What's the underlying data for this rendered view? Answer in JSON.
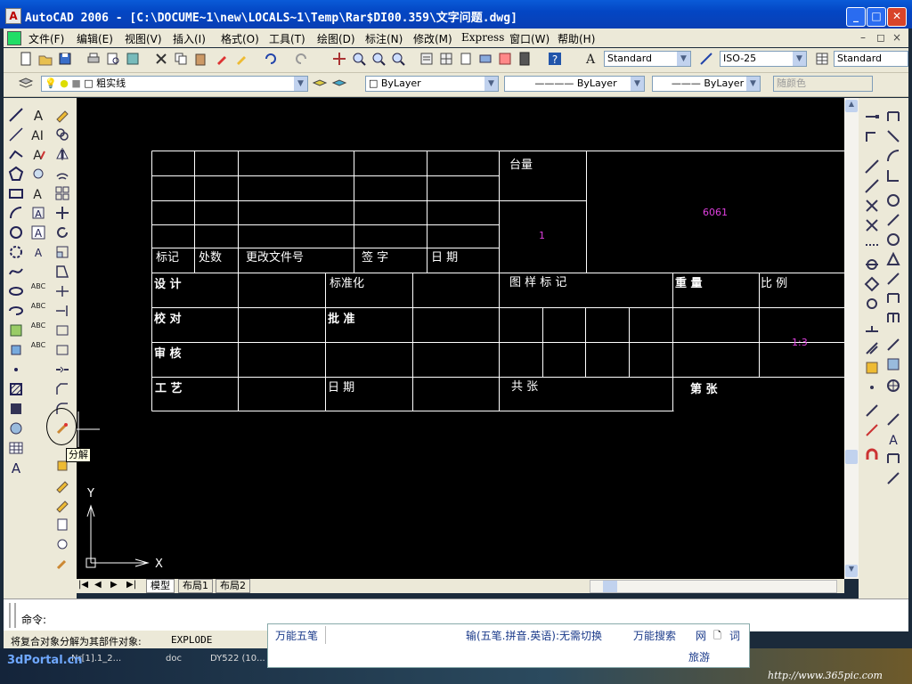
{
  "window": {
    "title": "AutoCAD 2006 - [C:\\DOCUME~1\\new\\LOCALS~1\\Temp\\Rar$DI00.359\\文字问题.dwg]",
    "icon_label": "A",
    "buttons": [
      "minimize-icon",
      "maximize-icon",
      "close-icon"
    ]
  },
  "menu": {
    "items": [
      "文件(F)",
      "编辑(E)",
      "视图(V)",
      "插入(I)",
      "格式(O)",
      "工具(T)",
      "绘图(D)",
      "标注(N)",
      "修改(M)",
      "Express",
      "窗口(W)",
      "帮助(H)"
    ],
    "mdi": [
      "–",
      "◻",
      "×"
    ]
  },
  "toolbar_styles": {
    "text_style": "Standard",
    "dim_style": "ISO-25",
    "table_style": "Standard"
  },
  "toolbar_layers": {
    "layer": "粗实线",
    "color": "ByLayer",
    "linetype": "ByLayer",
    "lineweight": "ByLayer",
    "plotstyle": "随颜色"
  },
  "drawing": {
    "title_block": {
      "row_labels": [
        "标记",
        "处数",
        "更改文件号",
        "签 字",
        "日 期"
      ],
      "taliang": "台量",
      "code": "6061",
      "count": "1",
      "design": "设 计",
      "standard": "标准化",
      "graphic_mark": "图 样 标 记",
      "weight": "重 量",
      "scale": "比 例",
      "check": "校 对",
      "approve": "批 准",
      "review": "审 核",
      "scale_value": "1:3",
      "process": "工 艺",
      "date": "日 期",
      "total_sheets": "共    张",
      "sheet_no": "第    张"
    },
    "ucs_x": "X",
    "ucs_y": "Y"
  },
  "tooltip": "分解",
  "layout_tabs": [
    "模型",
    "布局1",
    "布局2"
  ],
  "command": {
    "prompt": "命令:",
    "history": "将复合对象分解为其部件对象:",
    "command_name": "EXPLODE"
  },
  "ime": {
    "name": "万能五笔",
    "mode": "输(五笔.拼音.英语):无需切换",
    "search": "万能搜索",
    "net": "网",
    "doc": "词",
    "travel": "旅游"
  },
  "taskbar_fragments": {
    "a": "Nr[1].1_2...",
    "b": "doc",
    "c": "DY522 (10..."
  },
  "watermarks": {
    "left": "3dPortal.cn",
    "right": "http://www.365pic.com"
  }
}
